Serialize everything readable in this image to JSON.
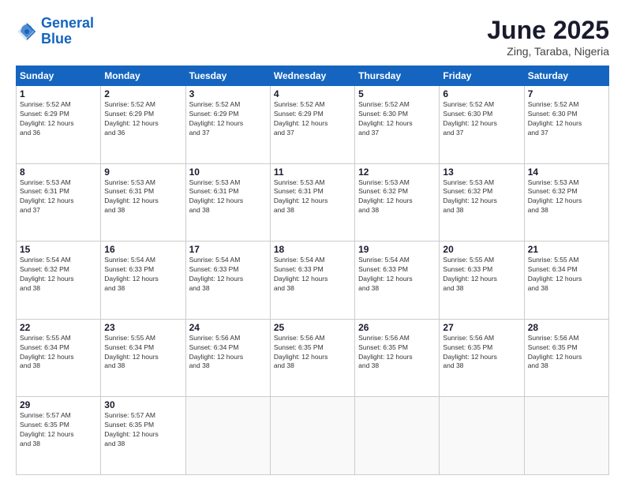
{
  "header": {
    "logo_line1": "General",
    "logo_line2": "Blue",
    "month": "June 2025",
    "location": "Zing, Taraba, Nigeria"
  },
  "weekdays": [
    "Sunday",
    "Monday",
    "Tuesday",
    "Wednesday",
    "Thursday",
    "Friday",
    "Saturday"
  ],
  "weeks": [
    [
      {
        "day": "1",
        "rise": "5:52 AM",
        "set": "6:29 PM",
        "hours": "12 hours",
        "mins": "36 minutes"
      },
      {
        "day": "2",
        "rise": "5:52 AM",
        "set": "6:29 PM",
        "hours": "12 hours",
        "mins": "36 minutes"
      },
      {
        "day": "3",
        "rise": "5:52 AM",
        "set": "6:29 PM",
        "hours": "12 hours",
        "mins": "37 minutes"
      },
      {
        "day": "4",
        "rise": "5:52 AM",
        "set": "6:29 PM",
        "hours": "12 hours",
        "mins": "37 minutes"
      },
      {
        "day": "5",
        "rise": "5:52 AM",
        "set": "6:30 PM",
        "hours": "12 hours",
        "mins": "37 minutes"
      },
      {
        "day": "6",
        "rise": "5:52 AM",
        "set": "6:30 PM",
        "hours": "12 hours",
        "mins": "37 minutes"
      },
      {
        "day": "7",
        "rise": "5:52 AM",
        "set": "6:30 PM",
        "hours": "12 hours",
        "mins": "37 minutes"
      }
    ],
    [
      {
        "day": "8",
        "rise": "5:53 AM",
        "set": "6:31 PM",
        "hours": "12 hours",
        "mins": "37 minutes"
      },
      {
        "day": "9",
        "rise": "5:53 AM",
        "set": "6:31 PM",
        "hours": "12 hours",
        "mins": "38 minutes"
      },
      {
        "day": "10",
        "rise": "5:53 AM",
        "set": "6:31 PM",
        "hours": "12 hours",
        "mins": "38 minutes"
      },
      {
        "day": "11",
        "rise": "5:53 AM",
        "set": "6:31 PM",
        "hours": "12 hours",
        "mins": "38 minutes"
      },
      {
        "day": "12",
        "rise": "5:53 AM",
        "set": "6:32 PM",
        "hours": "12 hours",
        "mins": "38 minutes"
      },
      {
        "day": "13",
        "rise": "5:53 AM",
        "set": "6:32 PM",
        "hours": "12 hours",
        "mins": "38 minutes"
      },
      {
        "day": "14",
        "rise": "5:53 AM",
        "set": "6:32 PM",
        "hours": "12 hours",
        "mins": "38 minutes"
      }
    ],
    [
      {
        "day": "15",
        "rise": "5:54 AM",
        "set": "6:32 PM",
        "hours": "12 hours",
        "mins": "38 minutes"
      },
      {
        "day": "16",
        "rise": "5:54 AM",
        "set": "6:33 PM",
        "hours": "12 hours",
        "mins": "38 minutes"
      },
      {
        "day": "17",
        "rise": "5:54 AM",
        "set": "6:33 PM",
        "hours": "12 hours",
        "mins": "38 minutes"
      },
      {
        "day": "18",
        "rise": "5:54 AM",
        "set": "6:33 PM",
        "hours": "12 hours",
        "mins": "38 minutes"
      },
      {
        "day": "19",
        "rise": "5:54 AM",
        "set": "6:33 PM",
        "hours": "12 hours",
        "mins": "38 minutes"
      },
      {
        "day": "20",
        "rise": "5:55 AM",
        "set": "6:33 PM",
        "hours": "12 hours",
        "mins": "38 minutes"
      },
      {
        "day": "21",
        "rise": "5:55 AM",
        "set": "6:34 PM",
        "hours": "12 hours",
        "mins": "38 minutes"
      }
    ],
    [
      {
        "day": "22",
        "rise": "5:55 AM",
        "set": "6:34 PM",
        "hours": "12 hours",
        "mins": "38 minutes"
      },
      {
        "day": "23",
        "rise": "5:55 AM",
        "set": "6:34 PM",
        "hours": "12 hours",
        "mins": "38 minutes"
      },
      {
        "day": "24",
        "rise": "5:56 AM",
        "set": "6:34 PM",
        "hours": "12 hours",
        "mins": "38 minutes"
      },
      {
        "day": "25",
        "rise": "5:56 AM",
        "set": "6:35 PM",
        "hours": "12 hours",
        "mins": "38 minutes"
      },
      {
        "day": "26",
        "rise": "5:56 AM",
        "set": "6:35 PM",
        "hours": "12 hours",
        "mins": "38 minutes"
      },
      {
        "day": "27",
        "rise": "5:56 AM",
        "set": "6:35 PM",
        "hours": "12 hours",
        "mins": "38 minutes"
      },
      {
        "day": "28",
        "rise": "5:56 AM",
        "set": "6:35 PM",
        "hours": "12 hours",
        "mins": "38 minutes"
      }
    ],
    [
      {
        "day": "29",
        "rise": "5:57 AM",
        "set": "6:35 PM",
        "hours": "12 hours",
        "mins": "38 minutes"
      },
      {
        "day": "30",
        "rise": "5:57 AM",
        "set": "6:35 PM",
        "hours": "12 hours",
        "mins": "38 minutes"
      },
      null,
      null,
      null,
      null,
      null
    ]
  ]
}
